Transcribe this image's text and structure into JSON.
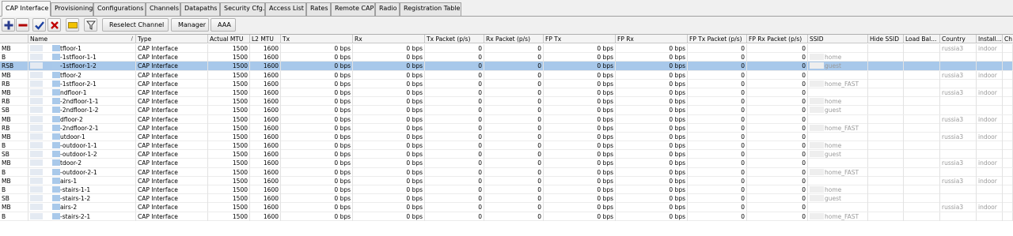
{
  "tabs": [
    {
      "label": "CAP Interface",
      "active": true
    },
    {
      "label": "Provisioning"
    },
    {
      "label": "Configurations"
    },
    {
      "label": "Channels"
    },
    {
      "label": "Datapaths"
    },
    {
      "label": "Security Cfg."
    },
    {
      "label": "Access List"
    },
    {
      "label": "Rates"
    },
    {
      "label": "Remote CAP"
    },
    {
      "label": "Radio"
    },
    {
      "label": "Registration Table"
    }
  ],
  "toolbar": {
    "reselect_label": "Reselect Channel",
    "manager_label": "Manager",
    "aaa_label": "AAA"
  },
  "columns": [
    "",
    "Name",
    "Type",
    "Actual MTU",
    "L2 MTU",
    "Tx",
    "Rx",
    "Tx Packet (p/s)",
    "Rx Packet (p/s)",
    "FP Tx",
    "FP Rx",
    "FP Tx Packet (p/s)",
    "FP Rx Packet (p/s)",
    "SSID",
    "Hide SSID",
    "Load Bal...",
    "Country",
    "Install...",
    "Ch"
  ],
  "rows": [
    {
      "flags": "MB",
      "name": "tfloor-1",
      "type": "CAP Interface",
      "mtu": "1500",
      "l2mtu": "1600",
      "tx": "0 bps",
      "rx": "0 bps",
      "txp": "0",
      "rxp": "0",
      "fptx": "0 bps",
      "fprx": "0 bps",
      "fptxp": "0",
      "fprxp": "0",
      "ssid": "",
      "country": "russia3",
      "install": "indoor"
    },
    {
      "flags": "B",
      "name": "-1stfloor-1-1",
      "type": "CAP Interface",
      "mtu": "1500",
      "l2mtu": "1600",
      "tx": "0 bps",
      "rx": "0 bps",
      "txp": "0",
      "rxp": "0",
      "fptx": "0 bps",
      "fprx": "0 bps",
      "fptxp": "0",
      "fprxp": "0",
      "ssid": "home",
      "country": "",
      "install": ""
    },
    {
      "flags": "RSB",
      "name": "-1stfloor-1-2",
      "type": "CAP Interface",
      "mtu": "1500",
      "l2mtu": "1600",
      "tx": "0 bps",
      "rx": "0 bps",
      "txp": "0",
      "rxp": "0",
      "fptx": "0 bps",
      "fprx": "0 bps",
      "fptxp": "0",
      "fprxp": "0",
      "ssid": "guest",
      "country": "",
      "install": ""
    },
    {
      "flags": "MB",
      "name": "tfloor-2",
      "type": "CAP Interface",
      "mtu": "1500",
      "l2mtu": "1600",
      "tx": "0 bps",
      "rx": "0 bps",
      "txp": "0",
      "rxp": "0",
      "fptx": "0 bps",
      "fprx": "0 bps",
      "fptxp": "0",
      "fprxp": "0",
      "ssid": "",
      "country": "russia3",
      "install": "indoor"
    },
    {
      "flags": "RB",
      "name": "-1stfloor-2-1",
      "type": "CAP Interface",
      "mtu": "1500",
      "l2mtu": "1600",
      "tx": "0 bps",
      "rx": "0 bps",
      "txp": "0",
      "rxp": "0",
      "fptx": "0 bps",
      "fprx": "0 bps",
      "fptxp": "0",
      "fprxp": "0",
      "ssid": "home_FAST",
      "country": "",
      "install": ""
    },
    {
      "flags": "MB",
      "name": "ndfloor-1",
      "type": "CAP Interface",
      "mtu": "1500",
      "l2mtu": "1600",
      "tx": "0 bps",
      "rx": "0 bps",
      "txp": "0",
      "rxp": "0",
      "fptx": "0 bps",
      "fprx": "0 bps",
      "fptxp": "0",
      "fprxp": "0",
      "ssid": "",
      "country": "russia3",
      "install": "indoor"
    },
    {
      "flags": "RB",
      "name": "-2ndfloor-1-1",
      "type": "CAP Interface",
      "mtu": "1500",
      "l2mtu": "1600",
      "tx": "0 bps",
      "rx": "0 bps",
      "txp": "0",
      "rxp": "0",
      "fptx": "0 bps",
      "fprx": "0 bps",
      "fptxp": "0",
      "fprxp": "0",
      "ssid": "home",
      "country": "",
      "install": ""
    },
    {
      "flags": "SB",
      "name": "-2ndfloor-1-2",
      "type": "CAP Interface",
      "mtu": "1500",
      "l2mtu": "1600",
      "tx": "0 bps",
      "rx": "0 bps",
      "txp": "0",
      "rxp": "0",
      "fptx": "0 bps",
      "fprx": "0 bps",
      "fptxp": "0",
      "fprxp": "0",
      "ssid": "guest",
      "country": "",
      "install": ""
    },
    {
      "flags": "MB",
      "name": "dfloor-2",
      "type": "CAP Interface",
      "mtu": "1500",
      "l2mtu": "1600",
      "tx": "0 bps",
      "rx": "0 bps",
      "txp": "0",
      "rxp": "0",
      "fptx": "0 bps",
      "fprx": "0 bps",
      "fptxp": "0",
      "fprxp": "0",
      "ssid": "",
      "country": "russia3",
      "install": "indoor"
    },
    {
      "flags": "RB",
      "name": "-2ndfloor-2-1",
      "type": "CAP Interface",
      "mtu": "1500",
      "l2mtu": "1600",
      "tx": "0 bps",
      "rx": "0 bps",
      "txp": "0",
      "rxp": "0",
      "fptx": "0 bps",
      "fprx": "0 bps",
      "fptxp": "0",
      "fprxp": "0",
      "ssid": "home_FAST",
      "country": "",
      "install": ""
    },
    {
      "flags": "MB",
      "name": "utdoor-1",
      "type": "CAP Interface",
      "mtu": "1500",
      "l2mtu": "1600",
      "tx": "0 bps",
      "rx": "0 bps",
      "txp": "0",
      "rxp": "0",
      "fptx": "0 bps",
      "fprx": "0 bps",
      "fptxp": "0",
      "fprxp": "0",
      "ssid": "",
      "country": "russia3",
      "install": "indoor"
    },
    {
      "flags": "B",
      "name": "-outdoor-1-1",
      "type": "CAP Interface",
      "mtu": "1500",
      "l2mtu": "1600",
      "tx": "0 bps",
      "rx": "0 bps",
      "txp": "0",
      "rxp": "0",
      "fptx": "0 bps",
      "fprx": "0 bps",
      "fptxp": "0",
      "fprxp": "0",
      "ssid": "home",
      "country": "",
      "install": ""
    },
    {
      "flags": "SB",
      "name": "-outdoor-1-2",
      "type": "CAP Interface",
      "mtu": "1500",
      "l2mtu": "1600",
      "tx": "0 bps",
      "rx": "0 bps",
      "txp": "0",
      "rxp": "0",
      "fptx": "0 bps",
      "fprx": "0 bps",
      "fptxp": "0",
      "fprxp": "0",
      "ssid": "guest",
      "country": "",
      "install": ""
    },
    {
      "flags": "MB",
      "name": "tdoor-2",
      "type": "CAP Interface",
      "mtu": "1500",
      "l2mtu": "1600",
      "tx": "0 bps",
      "rx": "0 bps",
      "txp": "0",
      "rxp": "0",
      "fptx": "0 bps",
      "fprx": "0 bps",
      "fptxp": "0",
      "fprxp": "0",
      "ssid": "",
      "country": "russia3",
      "install": "indoor"
    },
    {
      "flags": "B",
      "name": "-outdoor-2-1",
      "type": "CAP Interface",
      "mtu": "1500",
      "l2mtu": "1600",
      "tx": "0 bps",
      "rx": "0 bps",
      "txp": "0",
      "rxp": "0",
      "fptx": "0 bps",
      "fprx": "0 bps",
      "fptxp": "0",
      "fprxp": "0",
      "ssid": "home_FAST",
      "country": "",
      "install": ""
    },
    {
      "flags": "MB",
      "name": "airs-1",
      "type": "CAP Interface",
      "mtu": "1500",
      "l2mtu": "1600",
      "tx": "0 bps",
      "rx": "0 bps",
      "txp": "0",
      "rxp": "0",
      "fptx": "0 bps",
      "fprx": "0 bps",
      "fptxp": "0",
      "fprxp": "0",
      "ssid": "",
      "country": "russia3",
      "install": "indoor"
    },
    {
      "flags": "B",
      "name": "-stairs-1-1",
      "type": "CAP Interface",
      "mtu": "1500",
      "l2mtu": "1600",
      "tx": "0 bps",
      "rx": "0 bps",
      "txp": "0",
      "rxp": "0",
      "fptx": "0 bps",
      "fprx": "0 bps",
      "fptxp": "0",
      "fprxp": "0",
      "ssid": "home",
      "country": "",
      "install": ""
    },
    {
      "flags": "SB",
      "name": "-stairs-1-2",
      "type": "CAP Interface",
      "mtu": "1500",
      "l2mtu": "1600",
      "tx": "0 bps",
      "rx": "0 bps",
      "txp": "0",
      "rxp": "0",
      "fptx": "0 bps",
      "fprx": "0 bps",
      "fptxp": "0",
      "fprxp": "0",
      "ssid": "guest",
      "country": "",
      "install": ""
    },
    {
      "flags": "MB",
      "name": "airs-2",
      "type": "CAP Interface",
      "mtu": "1500",
      "l2mtu": "1600",
      "tx": "0 bps",
      "rx": "0 bps",
      "txp": "0",
      "rxp": "0",
      "fptx": "0 bps",
      "fprx": "0 bps",
      "fptxp": "0",
      "fprxp": "0",
      "ssid": "",
      "country": "russia3",
      "install": "indoor"
    },
    {
      "flags": "B",
      "name": "-stairs-2-1",
      "type": "CAP Interface",
      "mtu": "1500",
      "l2mtu": "1600",
      "tx": "0 bps",
      "rx": "0 bps",
      "txp": "0",
      "rxp": "0",
      "fptx": "0 bps",
      "fprx": "0 bps",
      "fptxp": "0",
      "fprxp": "0",
      "ssid": "home_FAST",
      "country": "",
      "install": ""
    }
  ],
  "selected_row_index": 2,
  "colors": {
    "selection": "#a8c8ea",
    "add_icon": "#2a3d8f",
    "remove_icon": "#b00000",
    "enable_icon": "#1a3fa0",
    "disable_icon": "#c00000",
    "comment_icon": "#f2c200"
  }
}
